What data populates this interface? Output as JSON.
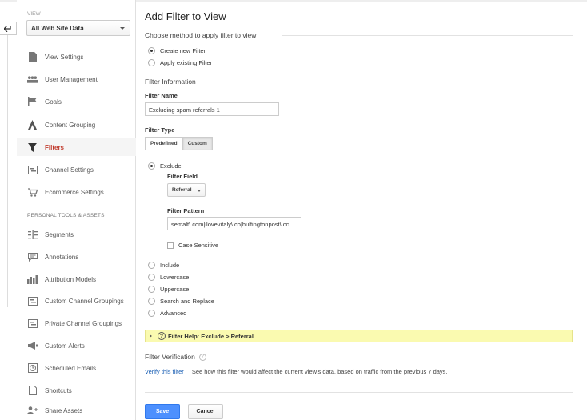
{
  "sidebar": {
    "view_label": "VIEW",
    "view_select": "All Web Site Data",
    "items": [
      {
        "label": "View Settings",
        "icon": "page-icon"
      },
      {
        "label": "User Management",
        "icon": "users-icon"
      },
      {
        "label": "Goals",
        "icon": "flag-icon"
      },
      {
        "label": "Content Grouping",
        "icon": "person-icon"
      },
      {
        "label": "Filters",
        "icon": "funnel-icon",
        "active": true
      },
      {
        "label": "Channel Settings",
        "icon": "channel-icon"
      },
      {
        "label": "Ecommerce Settings",
        "icon": "cart-icon"
      }
    ],
    "section_label": "PERSONAL TOOLS & ASSETS",
    "tools": [
      {
        "label": "Segments",
        "icon": "segments-icon"
      },
      {
        "label": "Annotations",
        "icon": "annotation-icon"
      },
      {
        "label": "Attribution Models",
        "icon": "bars-icon"
      },
      {
        "label": "Custom Channel Groupings",
        "icon": "channel-icon"
      },
      {
        "label": "Private Channel Groupings",
        "icon": "channel-icon"
      },
      {
        "label": "Custom Alerts",
        "icon": "megaphone-icon"
      },
      {
        "label": "Scheduled Emails",
        "icon": "clock-icon"
      },
      {
        "label": "Shortcuts",
        "icon": "page-icon"
      },
      {
        "label": "Share Assets",
        "icon": "share-icon"
      }
    ]
  },
  "main": {
    "title": "Add Filter to View",
    "method_title": "Choose method to apply filter to view",
    "method_options": [
      "Create new Filter",
      "Apply existing Filter"
    ],
    "info_title": "Filter Information",
    "filter_name_label": "Filter Name",
    "filter_name_value": "Excluding spam referrals 1",
    "filter_type_label": "Filter Type",
    "filter_type_tabs": [
      "Predefined",
      "Custom"
    ],
    "exclude_label": "Exclude",
    "filter_field_label": "Filter Field",
    "filter_field_value": "Referral",
    "filter_pattern_label": "Filter Pattern",
    "filter_pattern_value": "semalt\\.com|ilovevitaly\\.co|hulfingtonpost\\.cc",
    "case_sensitive_label": "Case Sensitive",
    "other_options": [
      "Include",
      "Lowercase",
      "Uppercase",
      "Search and Replace",
      "Advanced"
    ],
    "help_label": "Filter Help: Exclude  >  Referral",
    "verify_title": "Filter Verification",
    "verify_link": "Verify this filter",
    "verify_text": "See how this filter would affect the current view's data, based on traffic from the previous 7 days.",
    "save_label": "Save",
    "cancel_label": "Cancel"
  },
  "colors": {
    "accent_red": "#c0392b",
    "link_blue": "#1a5fb4",
    "save_blue": "#4d90fe",
    "help_yellow": "#fafab0"
  }
}
